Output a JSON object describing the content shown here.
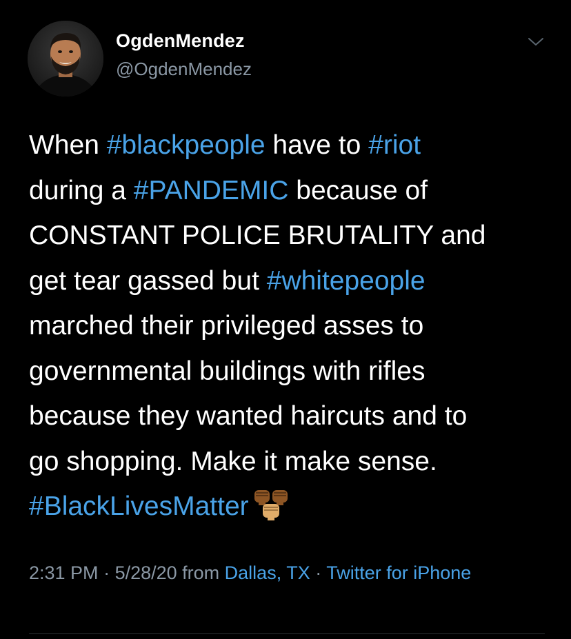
{
  "user": {
    "display_name": "OgdenMendez",
    "handle": "@OgdenMendez"
  },
  "tweet": {
    "lines": [
      [
        {
          "text": "When ",
          "tag": false
        },
        {
          "text": "#blackpeople",
          "tag": true
        },
        {
          "text": " have to ",
          "tag": false
        },
        {
          "text": "#riot",
          "tag": true
        }
      ],
      [
        {
          "text": "during a ",
          "tag": false
        },
        {
          "text": "#PANDEMIC",
          "tag": true
        },
        {
          "text": " because of",
          "tag": false
        }
      ],
      [
        {
          "text": "CONSTANT POLICE BRUTALITY and",
          "tag": false
        }
      ],
      [
        {
          "text": "get tear gassed but ",
          "tag": false
        },
        {
          "text": "#whitepeople",
          "tag": true
        }
      ],
      [
        {
          "text": "marched their privileged asses to",
          "tag": false
        }
      ],
      [
        {
          "text": "governmental buildings with rifles",
          "tag": false
        }
      ],
      [
        {
          "text": "because they wanted haircuts and to",
          "tag": false
        }
      ],
      [
        {
          "text": "go shopping. Make it make sense.",
          "tag": false
        }
      ],
      [
        {
          "text": "#BlackLivesMatter",
          "tag": true
        }
      ]
    ],
    "trailing_emoji": "raised-fist-emoji"
  },
  "meta": {
    "time": "2:31 PM",
    "separator": " · ",
    "date": "5/28/20",
    "from_word": " from ",
    "location": "Dallas, TX",
    "client": "Twitter for iPhone"
  },
  "colors": {
    "background": "#000000",
    "text": "#ffffff",
    "secondary": "#8b98a5",
    "link": "#4aa3e8",
    "skin_dark": "#8d5524",
    "skin_light": "#e0ac69"
  },
  "icons": {
    "menu": "chevron-down-icon",
    "avatar": "profile-photo"
  }
}
